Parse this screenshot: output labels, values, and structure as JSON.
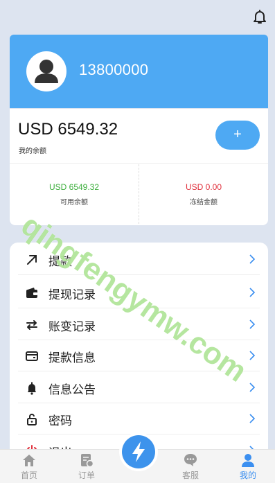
{
  "header": {
    "bell_icon": "bell-icon"
  },
  "profile": {
    "phone": "13800000",
    "avatar_icon": "user-avatar-icon"
  },
  "balance": {
    "amount": "USD 6549.32",
    "label": "我的余额",
    "add_button": "+",
    "available_amount": "USD 6549.32",
    "available_label": "可用余额",
    "frozen_amount": "USD 0.00",
    "frozen_label": "冻结金额"
  },
  "menu": {
    "items": [
      {
        "label": "提款",
        "icon": "arrow-up-right-icon"
      },
      {
        "label": "提现记录",
        "icon": "wallet-icon"
      },
      {
        "label": "账变记录",
        "icon": "swap-arrows-icon"
      },
      {
        "label": "提款信息",
        "icon": "card-icon"
      },
      {
        "label": "信息公告",
        "icon": "bell-icon"
      },
      {
        "label": "密码",
        "icon": "lock-icon"
      },
      {
        "label": "退出",
        "icon": "power-icon"
      }
    ]
  },
  "tabs": [
    {
      "label": "首页",
      "icon": "home-icon"
    },
    {
      "label": "订单",
      "icon": "order-icon"
    },
    {
      "label": "客服",
      "icon": "chat-icon"
    },
    {
      "label": "我的",
      "icon": "user-icon"
    }
  ],
  "watermark": "qingfengymw.com",
  "colors": {
    "accent": "#4ea9f3",
    "green": "#3cae3c",
    "red": "#e0303c"
  }
}
